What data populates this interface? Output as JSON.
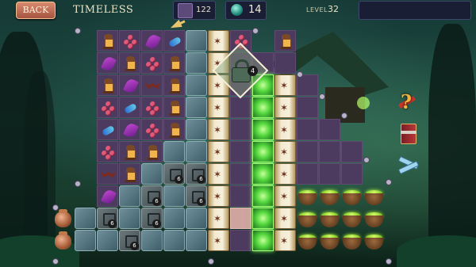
{
  "header": {
    "back_label": "BACK",
    "mode_title": "TIMELESS",
    "moves": "122",
    "gems": "14",
    "level_label": "LEVEL",
    "level_value": "32"
  },
  "board": {
    "lock_counter": "4",
    "stone_counter": "6"
  },
  "side_tools": [
    {
      "name": "hint-tool",
      "icon": "question-mark-icon"
    },
    {
      "name": "book-tool",
      "icon": "spell-book-icon"
    },
    {
      "name": "shuffle-tool",
      "icon": "shuffle-arrows-icon"
    }
  ],
  "colors": {
    "floor": "#4d3b5f",
    "stone": "#5a7a86",
    "glow_green": "#54d83e",
    "back_button": "#c06a52"
  }
}
